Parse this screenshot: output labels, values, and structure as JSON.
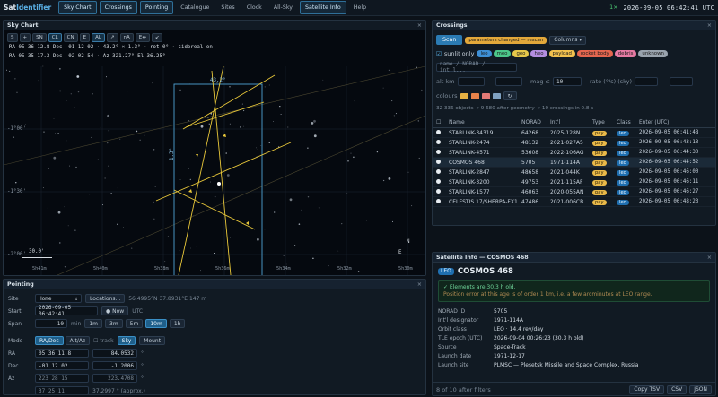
{
  "brand": {
    "a": "Sat",
    "b": "Identifier"
  },
  "nav": [
    {
      "label": "Sky Chart",
      "on": true
    },
    {
      "label": "Crossings",
      "on": true
    },
    {
      "label": "Pointing",
      "on": true
    },
    {
      "label": "Catalogue",
      "on": false
    },
    {
      "label": "Sites",
      "on": false
    },
    {
      "label": "Clock",
      "on": false
    },
    {
      "label": "All-Sky",
      "on": false
    },
    {
      "label": "Satellite Info",
      "on": true
    },
    {
      "label": "Help",
      "on": false
    }
  ],
  "topright": {
    "speed": "1×",
    "clock": "2026-09-05 06:42:41 UTC"
  },
  "sky": {
    "title": "Sky Chart",
    "close": "×",
    "tools": [
      "S",
      "+",
      "SN",
      "CL",
      "CN",
      "E",
      "AL",
      "↗",
      "nA",
      "E↔",
      "↙"
    ],
    "readout1": "RA 05 36 12.8  Dec -01 12 02  ·  43.2° × 1.3°  ·  rot 0°  ·  sidereal on",
    "readout2": "RA 05 35 17.3  Dec -02 02 54  ·  Az 321.27°  El 36.25°",
    "fovw": "43.2°",
    "fovh": "1.3°",
    "decl": [
      "-1°00'",
      "-1°30'",
      "-2°00'"
    ],
    "ral": [
      "5h41m",
      "5h40m",
      "5h38m",
      "5h36m",
      "5h34m",
      "5h32m",
      "5h30m"
    ],
    "scale": "30.0'",
    "north": "N",
    "east": "E"
  },
  "point": {
    "title": "Pointing",
    "close": "×",
    "site_label": "Site",
    "site_val": "Home",
    "site_btn": "Locations...",
    "site_coords": "56.4995°N  37.8931°E  147 m",
    "start_label": "Start",
    "start_val": "2026-09-05 06:42:41",
    "now_btn": "● Now",
    "utc": "UTC",
    "span_label": "Span",
    "span_val": "10",
    "span_unit": "min",
    "spans": [
      {
        "label": "1m",
        "on": false
      },
      {
        "label": "3m",
        "on": false
      },
      {
        "label": "5m",
        "on": false
      },
      {
        "label": "10m",
        "on": true
      },
      {
        "label": "1h",
        "on": false
      }
    ],
    "mode_label": "Mode",
    "modes": [
      {
        "label": "RA/Dec",
        "on": true
      },
      {
        "label": "Alt/Az",
        "on": false
      }
    ],
    "track": "track",
    "sky_btn": "Sky",
    "mount": "Mount",
    "ra_label": "RA",
    "ra_val": "05 36 11.8",
    "ra_deg": "84.0532",
    "deg": "°",
    "dec_label": "Dec",
    "dec_val": "-01 12 02",
    "dec_deg": "-1.2006",
    "az_label": "Az",
    "az_val": "223 28 15",
    "az_deg": "223.4708",
    "alt_val": "37 25 11",
    "alt_note": "37.2997 °   (approx.)"
  },
  "cross": {
    "title": "Crossings",
    "close": "×",
    "scan": "Scan",
    "changed": "parameters changed — rescan",
    "columns": "Columns ▾",
    "sunlit": "sunlit only",
    "pills": [
      {
        "label": "leo",
        "c": "#3d8fd6"
      },
      {
        "label": "meo",
        "c": "#4cc78a"
      },
      {
        "label": "geo",
        "c": "#e6c84a"
      },
      {
        "label": "heo",
        "c": "#b48ee0"
      },
      {
        "label": "payload",
        "c": "#f2c14e"
      },
      {
        "label": "rocket body",
        "c": "#e5664f"
      },
      {
        "label": "debris",
        "c": "#e67aa3"
      },
      {
        "label": "unknown",
        "c": "#9aa4ae"
      }
    ],
    "search_ph": "name / NORAD / int'l...",
    "altkm": "alt km",
    "dash": "—",
    "mag": "mag ≤",
    "mag_val": "10",
    "rate": "rate (°/s) (sky)",
    "colours": "colours",
    "swatches": [
      "#e6b143",
      "#e8834a",
      "#e27a76",
      "#7fa1c1"
    ],
    "stats": "32 336 objects → 9 680 after geometry → 10 crossings in 0.8 s",
    "cols": [
      "Name",
      "NORAD",
      "Int'l",
      "Type",
      "Class",
      "Enter (UTC)"
    ],
    "rows": [
      {
        "name": "STARLINK-34319",
        "norad": "64268",
        "intl": "2025-128N",
        "type": "pay",
        "cls": "leo",
        "enter": "2026-09-05 06:41:48",
        "sel": false
      },
      {
        "name": "STARLINK-2474",
        "norad": "48132",
        "intl": "2021-027A5",
        "type": "pay",
        "cls": "leo",
        "enter": "2026-09-05 06:43:13",
        "sel": false
      },
      {
        "name": "STARLINK-4571",
        "norad": "53608",
        "intl": "2022-106AG",
        "type": "pay",
        "cls": "leo",
        "enter": "2026-09-05 06:44:30",
        "sel": false
      },
      {
        "name": "COSMOS 468",
        "norad": "5705",
        "intl": "1971-114A",
        "type": "pay",
        "cls": "leo",
        "enter": "2026-09-05 06:44:52",
        "sel": true
      },
      {
        "name": "STARLINK-2847",
        "norad": "48658",
        "intl": "2021-044K",
        "type": "pay",
        "cls": "leo",
        "enter": "2026-09-05 06:46:00",
        "sel": false
      },
      {
        "name": "STARLINK-3200",
        "norad": "49753",
        "intl": "2021-115AF",
        "type": "pay",
        "cls": "leo",
        "enter": "2026-09-05 06:46:11",
        "sel": false
      },
      {
        "name": "STARLINK-1577",
        "norad": "46063",
        "intl": "2020-055AN",
        "type": "pay",
        "cls": "leo",
        "enter": "2026-09-05 06:46:27",
        "sel": false
      },
      {
        "name": "CELESTIS 17/SHERPA-FX1",
        "norad": "47486",
        "intl": "2021-006CB",
        "type": "pay",
        "cls": "leo",
        "enter": "2026-09-05 06:48:23",
        "sel": false
      }
    ]
  },
  "info": {
    "title": "Satellite Info — COSMOS 468",
    "close": "×",
    "badge": "LEO",
    "name": "COSMOS 468",
    "ok1": "✓ Elements are 30.3 h old.",
    "ok2": "Position error at this age is of order 1 km, i.e. a few arcminutes at LEO range.",
    "rows": [
      {
        "k": "NORAD ID",
        "v": "5705"
      },
      {
        "k": "Int'l designator",
        "v": "1971-114A"
      },
      {
        "k": "Orbit class",
        "v": "LEO · 14.4 rev/day"
      },
      {
        "k": "TLE epoch (UTC)",
        "v": "2026-09-04 00:26:23 (30.3 h old)"
      },
      {
        "k": "Source",
        "v": "Space-Track"
      },
      {
        "k": "Launch date",
        "v": "1971-12-17"
      },
      {
        "k": "Launch site",
        "v": "PLMSC — Plesetsk Missile and Space Complex, Russia"
      }
    ],
    "count": "8 of 10 after filters",
    "copy": "Copy TSV",
    "csv": "CSV",
    "json": "JSON"
  }
}
